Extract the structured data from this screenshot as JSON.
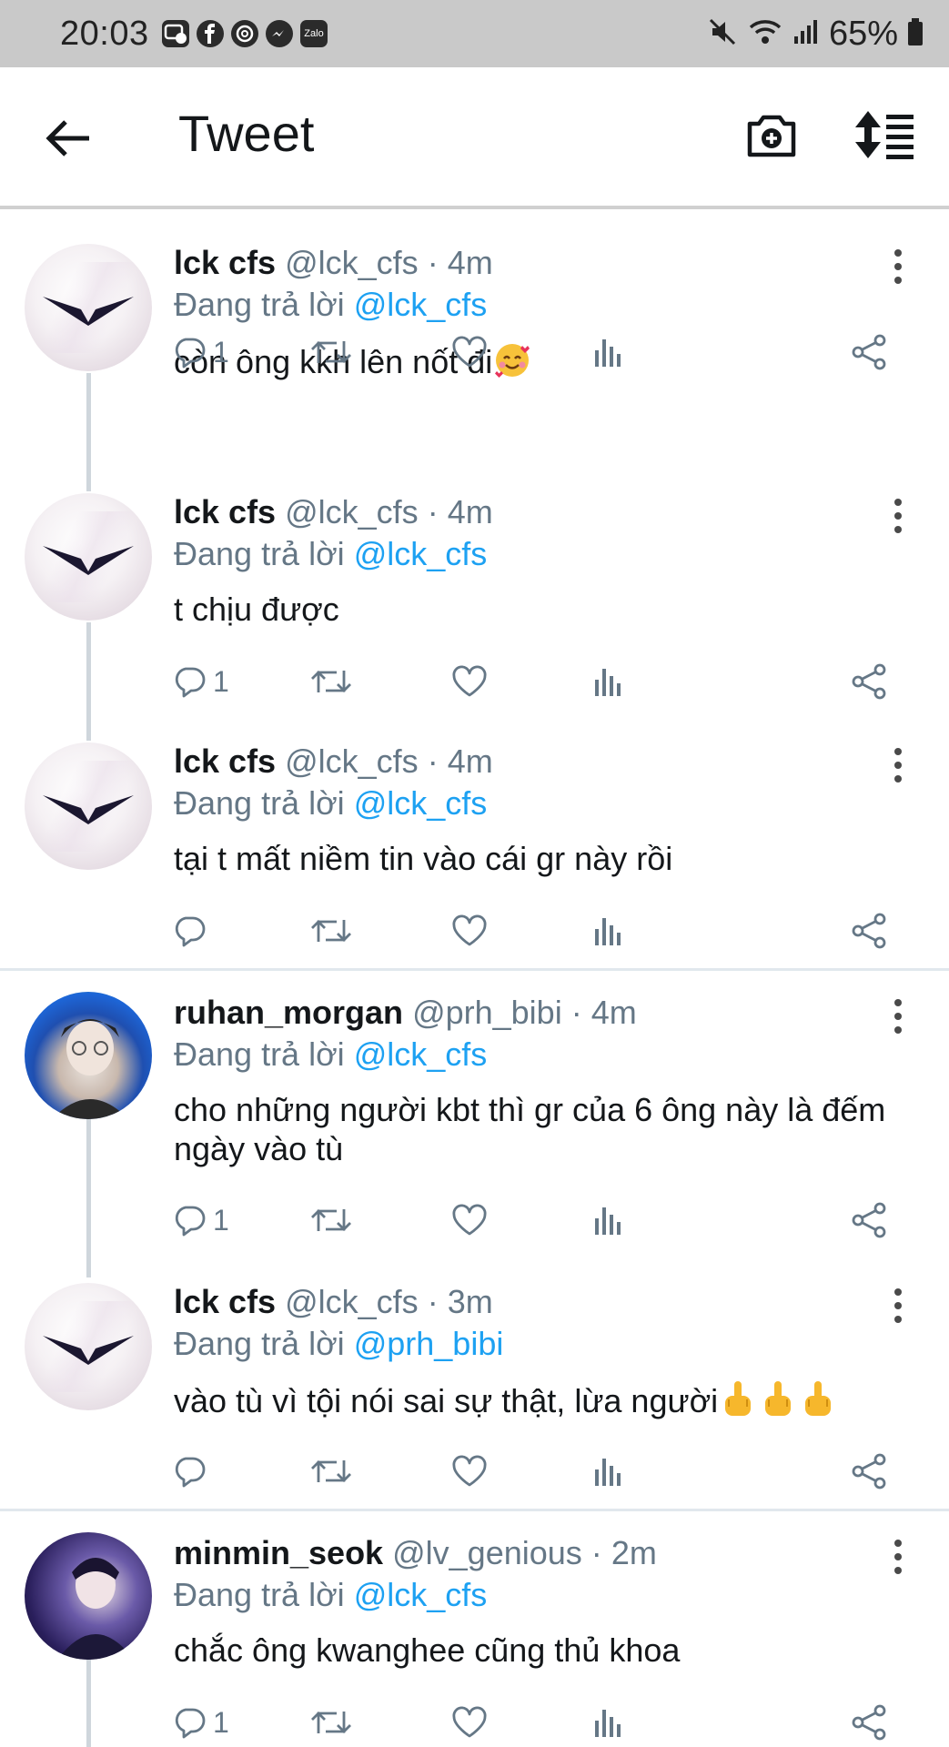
{
  "status_bar": {
    "time": "20:03",
    "apps": [
      "messenger-work-icon",
      "facebook-icon",
      "threads-icon",
      "messenger-icon",
      "zalo-icon"
    ],
    "zalo_label": "Zalo",
    "battery": "65%"
  },
  "header": {
    "title": "Tweet"
  },
  "reply_prefix": "Đang trả lời",
  "tweets": [
    {
      "name": "lck cfs",
      "handle": "@lck_cfs",
      "sep": "·",
      "time": "4m",
      "reply_to": "@lck_cfs",
      "text": "còn ông kkh lên nốt đi",
      "emoji": "smiling-face-with-hearts",
      "reply_count": "1"
    },
    {
      "name": "lck cfs",
      "handle": "@lck_cfs",
      "sep": "·",
      "time": "4m",
      "reply_to": "@lck_cfs",
      "text": "t chịu được",
      "reply_count": "1"
    },
    {
      "name": "lck cfs",
      "handle": "@lck_cfs",
      "sep": "·",
      "time": "4m",
      "reply_to": "@lck_cfs",
      "text": "tại t mất niềm tin vào cái gr này rồi",
      "reply_count": ""
    },
    {
      "name": "ruhan_morgan",
      "handle": "@prh_bibi",
      "sep": "·",
      "time": "4m",
      "reply_to": "@lck_cfs",
      "text_line1": "cho những người kbt thì gr của 6 ông này là đếm",
      "text_line2": "ngày vào tù",
      "reply_count": "1"
    },
    {
      "name": "lck cfs",
      "handle": "@lck_cfs",
      "sep": "·",
      "time": "3m",
      "reply_to": "@prh_bibi",
      "text": "vào tù vì tội nói sai sự thật, lừa người",
      "emoji": "middle-finger x3",
      "reply_count": ""
    },
    {
      "name": "minmin_seok",
      "handle": "@lv_genious",
      "sep": "·",
      "time": "2m",
      "reply_to": "@lck_cfs",
      "text": "chắc ông kwanghee cũng thủ khoa",
      "reply_count": "1"
    }
  ],
  "colors": {
    "link": "#1da1f2",
    "secondary_text": "#657786",
    "primary_text": "#14171a",
    "status_bar": "#c9c9c9"
  }
}
